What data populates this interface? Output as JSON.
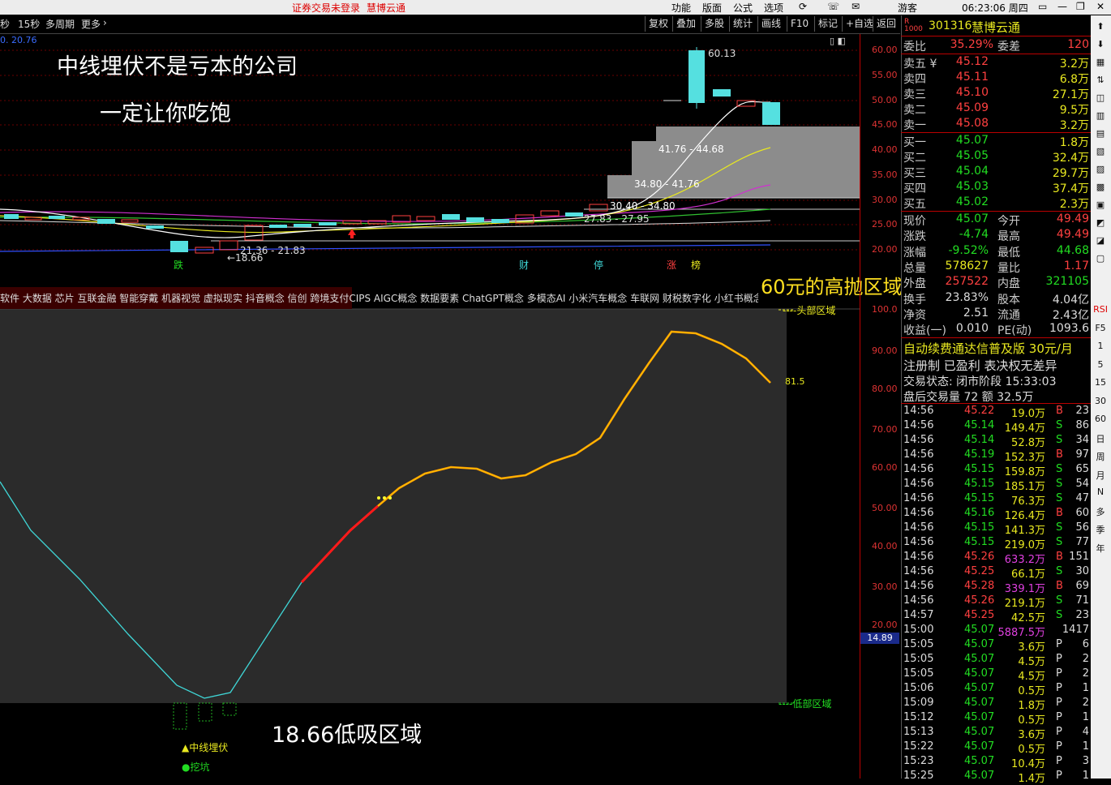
{
  "top_bar": {
    "notice": "证券交易未登录",
    "brand": "慧博云通",
    "menu": [
      "功能",
      "版面",
      "公式",
      "选项"
    ],
    "visitor": "游客",
    "clock": "06:23:06 周四"
  },
  "chart_toolbar": {
    "left": [
      "秒",
      "15秒",
      "多周期",
      "更多"
    ],
    "right": [
      "复权",
      "叠加",
      "多股",
      "统计",
      "画线",
      "F10",
      "标记",
      "+自选",
      "返回"
    ],
    "corner_value": "0. 20.76"
  },
  "annotations": {
    "headline": "中线埋伏不是亏本的公司",
    "subline": "一定让你吃饱",
    "high_zone": "60元的高抛区域",
    "low_zone": "18.66低吸区域"
  },
  "price_chart": {
    "high_label": "60.13",
    "low_label": "←18.66",
    "zone_labels": [
      "41.76 - 44.68",
      "34.80 - 41.76",
      "30.40 - 34.80",
      "27.83 - 27.95",
      "21.36 - 21.83"
    ],
    "event_tags": [
      "跌",
      "财",
      "停",
      "涨",
      "榜"
    ],
    "y_ticks": [
      "60.00",
      "55.00",
      "50.00",
      "45.00",
      "40.00",
      "35.00",
      "30.00",
      "25.00",
      "20.00"
    ]
  },
  "concept_bar": "软件 大数据 芯片 互联金融 智能穿戴 机器视觉 虚拟现实 抖音概念 信创 跨境支付CIPS AIGC概念 数据要素 ChatGPT概念 多模态AI 小米汽车概念 车联网 财税数字化 小红书概念",
  "indicator": {
    "head_label": "----头部区域",
    "bottom_label": "----低部区域",
    "current_value": "81.5",
    "current_axis": "14.89",
    "y_ticks": [
      "100.0",
      "90.00",
      "80.00",
      "70.00",
      "60.00",
      "50.00",
      "40.00",
      "30.00",
      "20.00"
    ],
    "legend": [
      "▲中线埋伏",
      "●挖坑"
    ]
  },
  "chart_data": {
    "type": "line",
    "title": "",
    "x": [
      0,
      1,
      2,
      3,
      4,
      5,
      6,
      7,
      8,
      9,
      10,
      11,
      12,
      13,
      14,
      15,
      16,
      17,
      18,
      19,
      20,
      21,
      22,
      23,
      24,
      25,
      26,
      27,
      28,
      29,
      30,
      31
    ],
    "series": [
      {
        "values": [
          58,
          45,
          37,
          30,
          21,
          13,
          2,
          0,
          1,
          15,
          28,
          40,
          47,
          52,
          56,
          58,
          58,
          57,
          58,
          61,
          63,
          68,
          78,
          87,
          95,
          94,
          91,
          87,
          81.5
        ]
      }
    ],
    "ylim": [
      0,
      100
    ]
  },
  "quote": {
    "code": "301316",
    "name": "慧博云通",
    "weibi": {
      "label": "委比",
      "value": "35.29%",
      "label2": "委差",
      "value2": "120"
    },
    "asks": [
      {
        "label": "卖五 ¥",
        "price": "45.12",
        "vol": "3.2万"
      },
      {
        "label": "卖四",
        "price": "45.11",
        "vol": "6.8万"
      },
      {
        "label": "卖三",
        "price": "45.10",
        "vol": "27.1万"
      },
      {
        "label": "卖二",
        "price": "45.09",
        "vol": "9.5万"
      },
      {
        "label": "卖一",
        "price": "45.08",
        "vol": "3.2万"
      }
    ],
    "bids": [
      {
        "label": "买一",
        "price": "45.07",
        "vol": "1.8万"
      },
      {
        "label": "买二",
        "price": "45.05",
        "vol": "32.4万"
      },
      {
        "label": "买三",
        "price": "45.04",
        "vol": "29.7万"
      },
      {
        "label": "买四",
        "price": "45.03",
        "vol": "37.4万"
      },
      {
        "label": "买五",
        "price": "45.02",
        "vol": "2.3万"
      }
    ],
    "stats": [
      {
        "l1": "现价",
        "v1": "45.07",
        "l2": "今开",
        "v2": "49.49",
        "c1": "grn",
        "c2": "red"
      },
      {
        "l1": "涨跌",
        "v1": "-4.74",
        "l2": "最高",
        "v2": "49.49",
        "c1": "grn",
        "c2": "red"
      },
      {
        "l1": "涨幅",
        "v1": "-9.52%",
        "l2": "最低",
        "v2": "44.68",
        "c1": "grn",
        "c2": "grn"
      },
      {
        "l1": "总量",
        "v1": "578627",
        "l2": "量比",
        "v2": "1.17",
        "c1": "yel",
        "c2": "red"
      },
      {
        "l1": "外盘",
        "v1": "257522",
        "l2": "内盘",
        "v2": "321105",
        "c1": "red",
        "c2": "grn"
      },
      {
        "l1": "换手",
        "v1": "23.83%",
        "l2": "股本",
        "v2": "4.04亿",
        "c1": "wht",
        "c2": "wht"
      },
      {
        "l1": "净资",
        "v1": "2.51",
        "l2": "流通",
        "v2": "2.43亿",
        "c1": "wht",
        "c2": "wht"
      },
      {
        "l1": "收益(一)",
        "v1": "0.010",
        "l2": "PE(动)",
        "v2": "1093.6",
        "c1": "wht",
        "c2": "wht"
      }
    ],
    "promo": "自动续费通达信普及版  30元/月",
    "reg": "注册制 已盈利 表决权无差异",
    "trade_state": "交易状态: 闭市阶段 15:33:03",
    "after_hours": "盘后交易量 72 额 32.5万"
  },
  "ticks": [
    {
      "t": "14:56",
      "p": "45.22",
      "v": "19.0万",
      "s": "B",
      "n": "23"
    },
    {
      "t": "14:56",
      "p": "45.14",
      "v": "149.4万",
      "s": "S",
      "n": "86"
    },
    {
      "t": "14:56",
      "p": "45.14",
      "v": "52.8万",
      "s": "S",
      "n": "34"
    },
    {
      "t": "14:56",
      "p": "45.19",
      "v": "152.3万",
      "s": "B",
      "n": "97"
    },
    {
      "t": "14:56",
      "p": "45.15",
      "v": "159.8万",
      "s": "S",
      "n": "65"
    },
    {
      "t": "14:56",
      "p": "45.15",
      "v": "185.1万",
      "s": "S",
      "n": "54"
    },
    {
      "t": "14:56",
      "p": "45.15",
      "v": "76.3万",
      "s": "S",
      "n": "47"
    },
    {
      "t": "14:56",
      "p": "45.16",
      "v": "126.4万",
      "s": "B",
      "n": "60"
    },
    {
      "t": "14:56",
      "p": "45.15",
      "v": "141.3万",
      "s": "S",
      "n": "56"
    },
    {
      "t": "14:56",
      "p": "45.15",
      "v": "219.0万",
      "s": "S",
      "n": "77"
    },
    {
      "t": "14:56",
      "p": "45.26",
      "v": "633.2万",
      "s": "B",
      "n": "151"
    },
    {
      "t": "14:56",
      "p": "45.25",
      "v": "66.1万",
      "s": "S",
      "n": "30"
    },
    {
      "t": "14:56",
      "p": "45.28",
      "v": "339.1万",
      "s": "B",
      "n": "69"
    },
    {
      "t": "14:56",
      "p": "45.26",
      "v": "219.1万",
      "s": "S",
      "n": "71"
    },
    {
      "t": "14:57",
      "p": "45.25",
      "v": "42.5万",
      "s": "S",
      "n": "23"
    },
    {
      "t": "15:00",
      "p": "45.07",
      "v": "5887.5万",
      "s": "",
      "n": "1417"
    },
    {
      "t": "15:05",
      "p": "45.07",
      "v": "3.6万",
      "s": "P",
      "n": "6"
    },
    {
      "t": "15:05",
      "p": "45.07",
      "v": "4.5万",
      "s": "P",
      "n": "2"
    },
    {
      "t": "15:05",
      "p": "45.07",
      "v": "4.5万",
      "s": "P",
      "n": "2"
    },
    {
      "t": "15:06",
      "p": "45.07",
      "v": "0.5万",
      "s": "P",
      "n": "1"
    },
    {
      "t": "15:09",
      "p": "45.07",
      "v": "1.8万",
      "s": "P",
      "n": "2"
    },
    {
      "t": "15:12",
      "p": "45.07",
      "v": "0.5万",
      "s": "P",
      "n": "1"
    },
    {
      "t": "15:13",
      "p": "45.07",
      "v": "3.6万",
      "s": "P",
      "n": "4"
    },
    {
      "t": "15:22",
      "p": "45.07",
      "v": "0.5万",
      "s": "P",
      "n": "1"
    },
    {
      "t": "15:23",
      "p": "45.07",
      "v": "10.4万",
      "s": "P",
      "n": "3"
    },
    {
      "t": "15:25",
      "p": "45.07",
      "v": "1.4万",
      "s": "P",
      "n": "1"
    }
  ],
  "side_strip": [
    "RSI",
    "F5",
    "1",
    "5",
    "15",
    "30",
    "60",
    "日",
    "周",
    "月",
    "N",
    "多",
    "季",
    "年"
  ]
}
